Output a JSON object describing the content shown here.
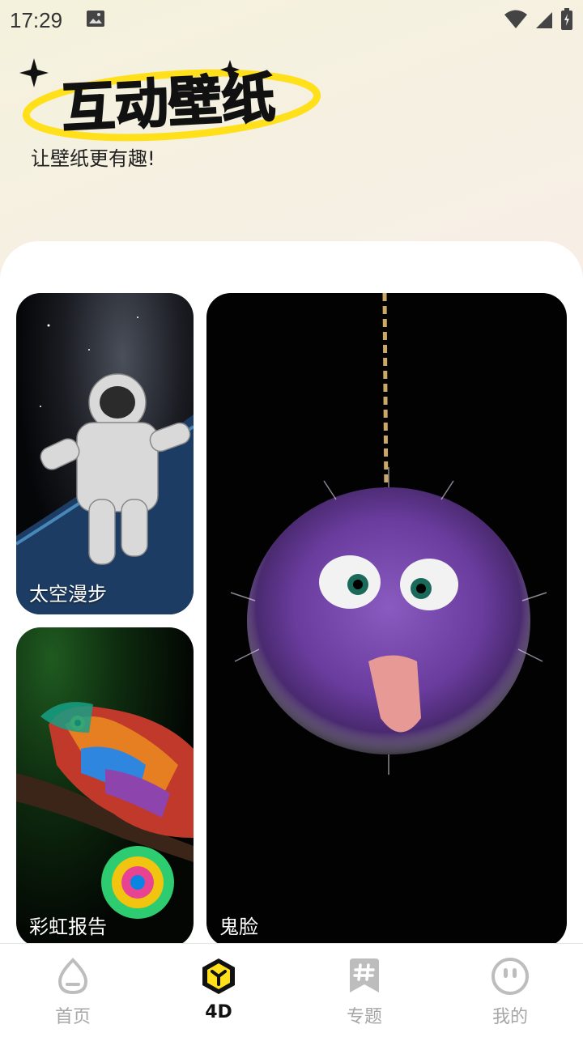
{
  "status_bar": {
    "time": "17:29"
  },
  "header": {
    "logo_text": "互动壁纸",
    "subtitle": "让壁纸更有趣!"
  },
  "cards": [
    {
      "label": "太空漫步",
      "image": "astronaut-floating-over-earth"
    },
    {
      "label": "鬼脸",
      "image": "purple-furball-tongue-out"
    },
    {
      "label": "彩虹报告",
      "image": "rainbow-knitted-chameleon"
    }
  ],
  "bottom_nav": {
    "items": [
      {
        "label": "首页",
        "icon": "home-drop-icon",
        "active": false
      },
      {
        "label": "4D",
        "icon": "cube-4d-icon",
        "active": true
      },
      {
        "label": "专题",
        "icon": "hashtag-bookmark-icon",
        "active": false
      },
      {
        "label": "我的",
        "icon": "face-smile-icon",
        "active": false
      }
    ]
  },
  "colors": {
    "accent_yellow": "#ffe01a",
    "active_text": "#111111",
    "inactive": "#a6a6a6"
  }
}
